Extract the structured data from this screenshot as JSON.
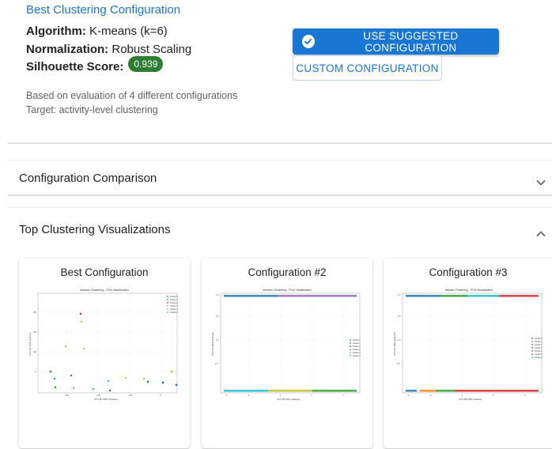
{
  "best": {
    "title": "Best Clustering Configuration",
    "algorithm_label": "Algorithm:",
    "algorithm_value": "K-means (k=6)",
    "normalization_label": "Normalization:",
    "normalization_value": "Robust Scaling",
    "silhouette_label": "Silhouette Score:",
    "silhouette_value": "0.939",
    "evaluation_note": "Based on evaluation of 4 different configurations",
    "target_note": "Target: activity-level clustering"
  },
  "actions": {
    "use_suggested_label": "USE SUGGESTED CONFIGURATION",
    "custom_label": "CUSTOM CONFIGURATION"
  },
  "sections": {
    "comparison_title": "Configuration Comparison",
    "visualizations_title": "Top Clustering Visualizations"
  },
  "colors": {
    "accent": "#1976d2",
    "score_chip": "#2e7d32"
  },
  "cards": [
    {
      "title": "Best Configuration",
      "plot_title": "kmeans Clustering - PCA Visualization",
      "xlabel": "PC1 (61.60% variance)",
      "ylabel": "PC2 (16.12% variance)",
      "legend": [
        "Cluster 0",
        "Cluster 1",
        "Cluster 2",
        "Cluster 3",
        "Cluster 4",
        "Cluster 5"
      ]
    },
    {
      "title": "Configuration #2",
      "plot_title": "kmeans Clustering - PCA Visualization",
      "xlabel": "PC1 (56.40% variance)",
      "ylabel": "PC2 (21.18% variance)",
      "legend": [
        "Cluster 0",
        "Cluster 1",
        "Cluster 2",
        "Cluster 3",
        "Cluster 4",
        "Cluster 5"
      ]
    },
    {
      "title": "Configuration #3",
      "plot_title": "dbscan Clustering - PCA Visualization",
      "xlabel": "PC1 (56.40% variance)",
      "ylabel": "PC2 (21.18% variance)",
      "legend": [
        "Cluster 0",
        "Cluster 1",
        "Cluster 2",
        "Cluster 3",
        "Cluster 4",
        "Cluster 5",
        "Cluster 6"
      ]
    }
  ]
}
